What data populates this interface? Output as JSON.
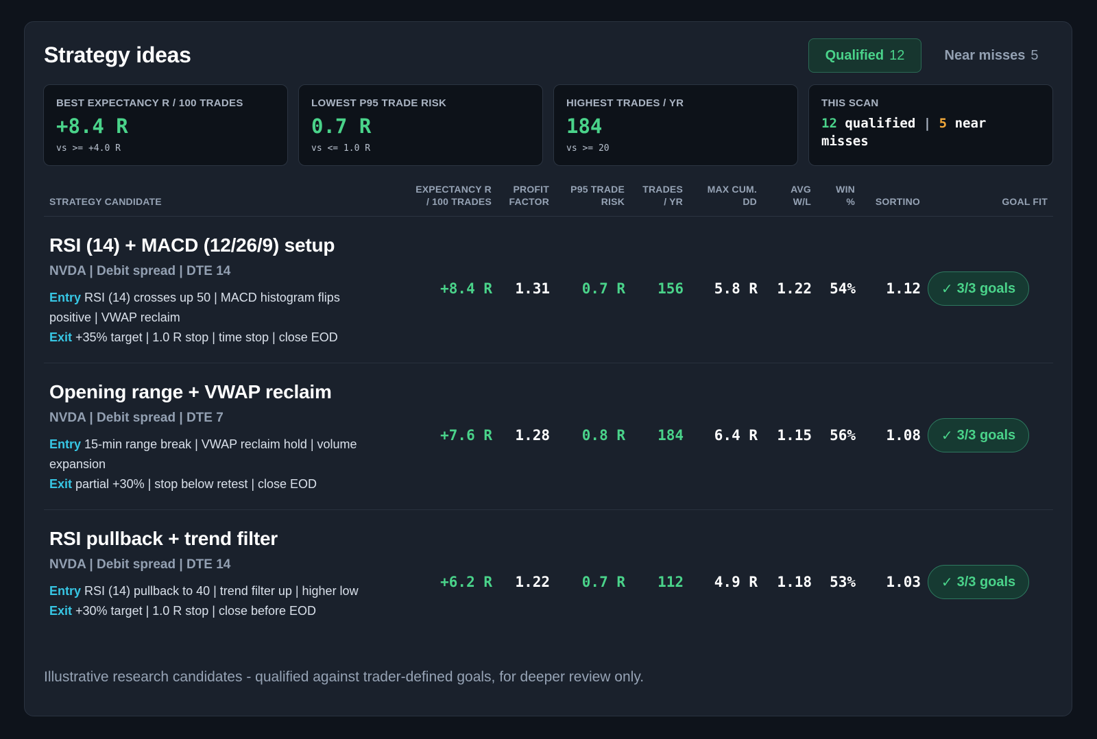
{
  "title": "Strategy ideas",
  "tabs": [
    {
      "label": "Qualified",
      "count": "12"
    },
    {
      "label": "Near misses",
      "count": "5"
    }
  ],
  "stats": [
    {
      "label": "BEST EXPECTANCY R / 100 TRADES",
      "value": "+8.4 R",
      "sub": "vs >= +4.0 R"
    },
    {
      "label": "LOWEST P95 TRADE RISK",
      "value": "0.7 R",
      "sub": "vs <= 1.0 R"
    },
    {
      "label": "HIGHEST TRADES / YR",
      "value": "184",
      "sub": "vs >= 20"
    }
  ],
  "scan": {
    "label": "THIS SCAN",
    "qualified_count": "12",
    "qualified_word": "qualified",
    "separator": "|",
    "near_count": "5",
    "near_word": "near misses"
  },
  "columns": {
    "candidate": "STRATEGY CANDIDATE",
    "expectancy_1": "EXPECTANCY R",
    "expectancy_2": "/ 100 TRADES",
    "profit_1": "PROFIT",
    "profit_2": "FACTOR",
    "p95_1": "P95 TRADE",
    "p95_2": "RISK",
    "trades_1": "TRADES",
    "trades_2": "/ YR",
    "maxdd_1": "MAX CUM.",
    "maxdd_2": "DD",
    "avgwl_1": "AVG",
    "avgwl_2": "W/L",
    "win_1": "WIN",
    "win_2": "%",
    "sortino": "SORTINO",
    "goal_fit": "GOAL FIT"
  },
  "rows": [
    {
      "name": "RSI (14) + MACD (12/26/9) setup",
      "meta": "NVDA | Debit spread | DTE 14",
      "entry_label": "Entry",
      "entry": "RSI (14) crosses up 50 | MACD histogram flips positive | VWAP reclaim",
      "exit_label": "Exit",
      "exit": "+35% target | 1.0 R stop | time stop | close EOD",
      "expectancy": "+8.4 R",
      "profit_factor": "1.31",
      "p95_risk": "0.7 R",
      "trades_yr": "156",
      "max_dd": "5.8 R",
      "avg_wl": "1.22",
      "win_pct": "54%",
      "sortino": "1.12",
      "goal_check": "✓",
      "goal_fit": "3/3 goals"
    },
    {
      "name": "Opening range + VWAP reclaim",
      "meta": "NVDA | Debit spread | DTE 7",
      "entry_label": "Entry",
      "entry": "15-min range break | VWAP reclaim hold | volume expansion",
      "exit_label": "Exit",
      "exit": "partial +30% | stop below retest | close EOD",
      "expectancy": "+7.6 R",
      "profit_factor": "1.28",
      "p95_risk": "0.8 R",
      "trades_yr": "184",
      "max_dd": "6.4 R",
      "avg_wl": "1.15",
      "win_pct": "56%",
      "sortino": "1.08",
      "goal_check": "✓",
      "goal_fit": "3/3 goals"
    },
    {
      "name": "RSI pullback + trend filter",
      "meta": "NVDA | Debit spread | DTE 14",
      "entry_label": "Entry",
      "entry": "RSI (14) pullback to 40 | trend filter up | higher low",
      "exit_label": "Exit",
      "exit": "+30% target | 1.0 R stop | close before EOD",
      "expectancy": "+6.2 R",
      "profit_factor": "1.22",
      "p95_risk": "0.7 R",
      "trades_yr": "112",
      "max_dd": "4.9 R",
      "avg_wl": "1.18",
      "win_pct": "53%",
      "sortino": "1.03",
      "goal_check": "✓",
      "goal_fit": "3/3 goals"
    }
  ],
  "footer": "Illustrative research candidates - qualified against trader-defined goals, for deeper review only."
}
